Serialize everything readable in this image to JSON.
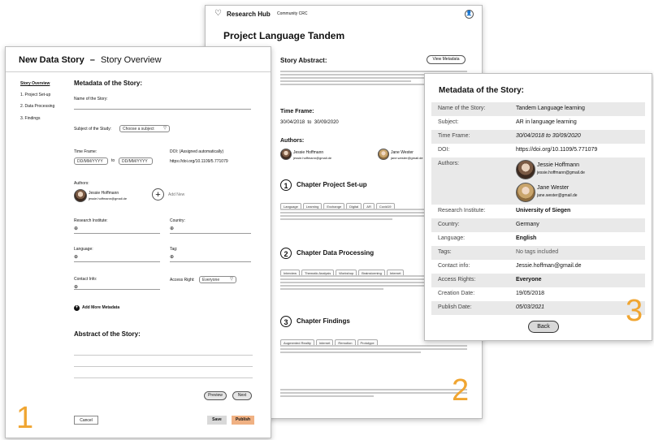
{
  "screen2": {
    "brand": "Research Hub",
    "community": "Community CRC",
    "title": "Project Language Tandem",
    "abstract_heading": "Story Abstract:",
    "view_metadata": "View Metadata",
    "timeframe_heading": "Time Frame:",
    "date_from": "30/04/2018",
    "to": "to",
    "date_to": "30/09/2020",
    "authors_heading": "Authors:",
    "authors": [
      {
        "name": "Jessie Hoffmann",
        "email": "jessie.hoffmann@gmail.de"
      },
      {
        "name": "Jane Wester",
        "email": "jane.wester@gmail.de"
      }
    ],
    "chapters": [
      {
        "num": "1",
        "title": "Chapter Project Set-up",
        "tags": [
          "Language",
          "Learning",
          "Exchange",
          "Digital",
          "AR",
          "Covid19"
        ]
      },
      {
        "num": "2",
        "title": "Chapter Data Processing",
        "tags": [
          "Interview",
          "Thematic Analysis",
          "Workshop",
          "Brainstorming",
          "Internet"
        ]
      },
      {
        "num": "3",
        "title": "Chapter Findings",
        "tags": [
          "Augmented Reality",
          "Internet",
          "Remotion",
          "Prototype"
        ]
      }
    ]
  },
  "screen1": {
    "header_title": "New Data Story",
    "header_dash": "–",
    "header_sub": "Story Overview",
    "nav": [
      "Story Overview",
      "1. Project Set-up",
      "2. Data Processing",
      "3. Findings"
    ],
    "meta_heading": "Metadata of the Story:",
    "name_label": "Name of the Story:",
    "subject_label": "Subject of the Study:",
    "subject_select": "Choose a subject",
    "timeframe_label": "Time Frame:",
    "date_placeholder_from": "DD/MM/YYYY",
    "to": "to",
    "date_placeholder_to": "DD/MM/YYYY",
    "doi_label": "DOI: (Assigned automatically)",
    "doi_value": "https://doi.org/10.1109/5.771079",
    "authors_label": "Authors:",
    "author_name": "Jessie Hoffmann",
    "author_email": "jessie.hoffmann@gmail.de",
    "add_new": "Add New",
    "institute_label": "Research Institute:",
    "country_label": "Country:",
    "language_label": "Language:",
    "tag_label": "Tag:",
    "contact_label": "Contact Info:",
    "access_label": "Access Right:",
    "access_value": "Everyone",
    "add_more": "Add More Metadata",
    "abstract_heading": "Abstract of the Story:",
    "preview": "Preview",
    "next": "Next",
    "cancel": "Cancel",
    "save": "Save",
    "publish": "Publish",
    "colors": {
      "publish_bg": "#f0b183",
      "save_bg": "#d9d9d9"
    }
  },
  "screen3": {
    "heading": "Metadata of the Story:",
    "rows": [
      {
        "key": "Name of the Story:",
        "value": "Tandem Language learning"
      },
      {
        "key": "Subject:",
        "value": "AR in language learning"
      },
      {
        "key": "Time Frame:",
        "value": "30/04/2018 to 30/09/2020"
      },
      {
        "key": "DOI:",
        "value": "https://doi.org/10.1109/5.771079"
      },
      {
        "key": "Authors:",
        "value": ""
      },
      {
        "key": "Research Institute:",
        "value": "University of Siegen"
      },
      {
        "key": "Country:",
        "value": "Germany"
      },
      {
        "key": "Language:",
        "value": "English"
      },
      {
        "key": "Tags:",
        "value": "No tags included"
      },
      {
        "key": "Contact info:",
        "value": "Jessie.hoffman@gmail.de"
      },
      {
        "key": "Access Rights:",
        "value": "Everyone"
      },
      {
        "key": "Creation Date:",
        "value": "19/05/2018"
      },
      {
        "key": "Publish Date:",
        "value": "05/03/2021"
      }
    ],
    "authors": [
      {
        "name": "Jessie Hoffmann",
        "email": "jessie.hoffmann@gmail.de"
      },
      {
        "name": "Jane Wester",
        "email": "jane.wester@gmail.de"
      }
    ],
    "back": "Back"
  },
  "labels": {
    "n1": "1",
    "n2": "2",
    "n3": "3"
  },
  "accent_color": "#f0a531"
}
